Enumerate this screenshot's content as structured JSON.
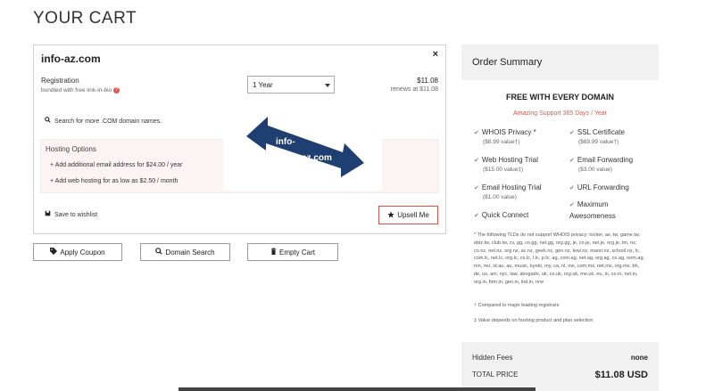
{
  "page": {
    "title": "YOUR CART"
  },
  "cart_item": {
    "domain": "info-az.com",
    "close_icon": "×",
    "registration_label": "Registration",
    "registration_sub": "bundled with free link-in-bio",
    "info_icon": "?",
    "term_selected": "1 Year",
    "price": "$11.08",
    "renews": "renews at $11.08",
    "search_more": "Search for more .COM domain names.",
    "hosting": {
      "title": "Hosting Options",
      "options": [
        "+ Add additional email address for $24.00 / year",
        "+ Add web hosting for as low as $2.50 / month"
      ]
    },
    "wishlist": "Save to wishlist",
    "upsell": "Upsell Me"
  },
  "actions": {
    "apply_coupon": "Apply Coupon",
    "domain_search": "Domain Search",
    "empty_cart": "Empty Cart"
  },
  "overlay": {
    "line1": "info-",
    "line2": "az.com",
    "arrow_color": "#1f3f73"
  },
  "summary": {
    "title": "Order Summary",
    "free_title": "FREE WITH EVERY DOMAIN",
    "support": "Amazing Support 365 Days / Year",
    "features": [
      {
        "name": "WHOIS Privacy *",
        "price": "($8.99 value†)"
      },
      {
        "name": "SSL Certificate",
        "price": "($69.99 value†)"
      },
      {
        "name": "Web Hosting Trial",
        "price": "($15.00 value‡)"
      },
      {
        "name": "Email Forwarding",
        "price": "($3.00 value)"
      },
      {
        "name": "Email Hosting Trial",
        "price": "($1.00 value)"
      },
      {
        "name": "URL Forwarding",
        "price": ""
      },
      {
        "name": "Quick Connect",
        "price": ""
      },
      {
        "name": "Maximum Awesomeness",
        "price": ""
      }
    ],
    "fine_print": "* The following TLDs do not support WHOIS privacy: locker, as, tw, game.tw, ebiz.tw, club.tw, cv, gg, co.gg, net.gg, org.gg, je, co.je, net.je, org.je, tm, nz, co.nz, net.nz, org.nz, ac.nz, geek.nz, gen.nz, kiwi.nz, maori.nz, school.nz, lc, com.lc, net.lc, org.lc, co.lc, l.lc, p.lc, ag, com.ag, net.ag, org.ag, co.ag, nom.ag, mn, mu, id.au, au, music, kyoto, my, ca, nl, mx, com.mx, net.mx, org.mx, bh, de, us, am, nyc, law, abogado, uk, co.uk, org.uk, me.uk, eu, in, co.in, net.in, org.in, firm.in, gen.in, ind.in, nrw",
    "note_compared": "Compared to major leading registrars",
    "note_compared_mark": "†",
    "note_value": "Value depends on hosting product and plan selection",
    "note_value_mark": "‡",
    "hidden_fees_label": "Hidden Fees",
    "hidden_fees_value": "none",
    "total_label": "TOTAL PRICE",
    "total_value": "$11.08 USD"
  },
  "colors": {
    "accent_red": "#e05a4f",
    "summary_bg": "#f1f1f1",
    "arrow_blue": "#1f3f73"
  },
  "icons": [
    "close-icon",
    "info-icon",
    "caret-down-icon",
    "search-icon",
    "save-icon",
    "star-icon",
    "tag-icon",
    "trash-icon",
    "check-icon"
  ]
}
